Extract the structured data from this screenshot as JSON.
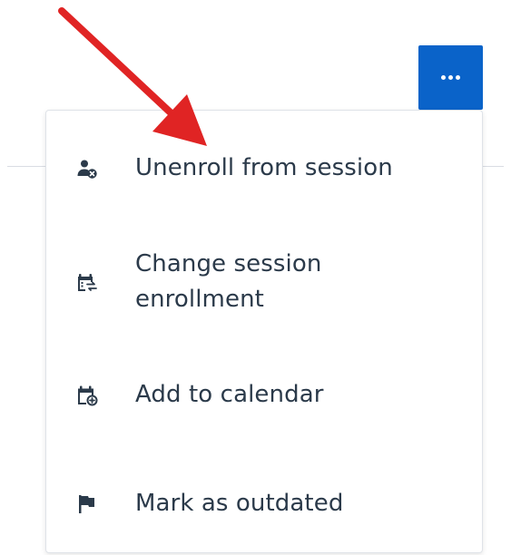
{
  "colors": {
    "accent": "#0a63c9",
    "text": "#2b3a4a",
    "icon": "#2b3a4a",
    "annotation_arrow": "#e02424"
  },
  "toolbar": {
    "more_button_icon": "ellipsis-icon"
  },
  "menu": {
    "items": [
      {
        "label": "Unenroll from session",
        "icon": "user-remove-icon"
      },
      {
        "label": "Change session enrollment",
        "icon": "calendar-swap-icon"
      },
      {
        "label": "Add to calendar",
        "icon": "calendar-add-icon"
      },
      {
        "label": "Mark as outdated",
        "icon": "flag-icon"
      }
    ]
  },
  "annotation": {
    "icon": "red-arrow-icon"
  }
}
